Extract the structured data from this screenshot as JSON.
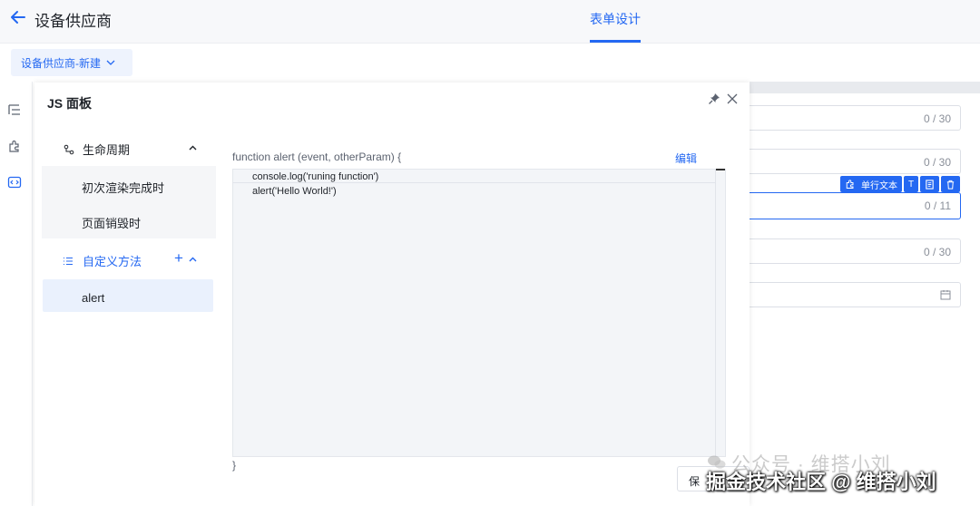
{
  "header": {
    "title": "设备供应商",
    "active_tab": "表单设计"
  },
  "subbar": {
    "form_select": "设备供应商-新建"
  },
  "left_rail": {
    "icons": [
      "outline-icon",
      "plugin-icon",
      "code-icon"
    ]
  },
  "background_form": {
    "counters": [
      "0 / 30",
      "0 / 30",
      "0 / 11",
      "0 / 30"
    ],
    "widget_toolbar": {
      "type_label": "单行文本",
      "text_button": "T"
    }
  },
  "panel": {
    "title": "JS 面板",
    "lifecycle": {
      "label": "生命周期",
      "items": [
        "初次渲染完成时",
        "页面销毁时"
      ]
    },
    "custom_methods": {
      "label": "自定义方法",
      "add": "+",
      "items": [
        "alert"
      ]
    },
    "editor": {
      "signature": "function alert (event, otherParam) {",
      "edit_label": "编辑",
      "lines": [
        "console.log('runing function')",
        "alert('Hello World!')"
      ],
      "closing": "}"
    },
    "save_label": "保"
  },
  "watermarks": {
    "wechat": "公众号 · 维搭小刘",
    "site": "掘金技术社区 @ 维搭小刘"
  },
  "colors": {
    "accent": "#2468f2",
    "selected_bg": "#eaf1fd"
  }
}
